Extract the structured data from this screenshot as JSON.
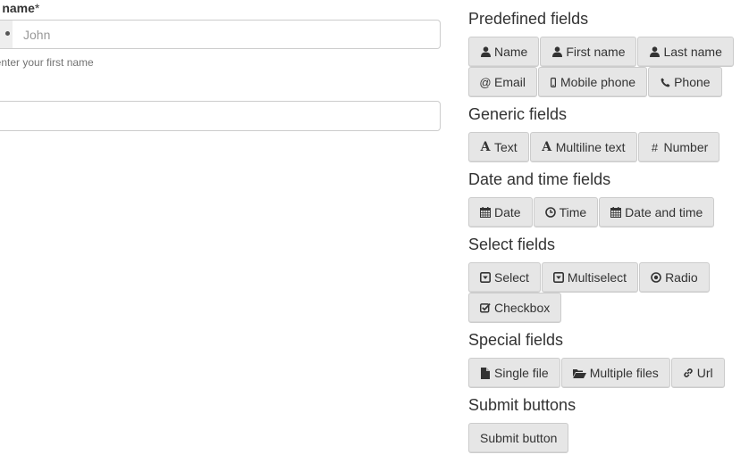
{
  "form": {
    "field_label": "st name",
    "required_mark": "*",
    "input_placeholder": "John",
    "help_text": "ase enter your first name"
  },
  "palette": {
    "predefined": {
      "title": "Predefined fields",
      "buttons": [
        {
          "label": "Name",
          "icon": "user-icon"
        },
        {
          "label": "First name",
          "icon": "user-icon"
        },
        {
          "label": "Last name",
          "icon": "user-icon"
        },
        {
          "label": "Email",
          "icon": "at-icon"
        },
        {
          "label": "Mobile phone",
          "icon": "mobile-icon"
        },
        {
          "label": "Phone",
          "icon": "phone-icon"
        }
      ]
    },
    "generic": {
      "title": "Generic fields",
      "buttons": [
        {
          "label": "Text",
          "icon": "font-icon"
        },
        {
          "label": "Multiline text",
          "icon": "font-icon"
        },
        {
          "label": "Number",
          "icon": "hash-icon"
        }
      ]
    },
    "datetime": {
      "title": "Date and time fields",
      "buttons": [
        {
          "label": "Date",
          "icon": "calendar-icon"
        },
        {
          "label": "Time",
          "icon": "clock-icon"
        },
        {
          "label": "Date and time",
          "icon": "calendar-icon"
        }
      ]
    },
    "select": {
      "title": "Select fields",
      "buttons": [
        {
          "label": "Select",
          "icon": "caret-square-icon"
        },
        {
          "label": "Multiselect",
          "icon": "caret-square-icon"
        },
        {
          "label": "Radio",
          "icon": "dot-circle-icon"
        },
        {
          "label": "Checkbox",
          "icon": "check-square-icon"
        }
      ]
    },
    "special": {
      "title": "Special fields",
      "buttons": [
        {
          "label": "Single file",
          "icon": "file-icon"
        },
        {
          "label": "Multiple files",
          "icon": "folder-open-icon"
        },
        {
          "label": "Url",
          "icon": "link-icon"
        }
      ]
    },
    "submit": {
      "title": "Submit buttons",
      "buttons": [
        {
          "label": "Submit button",
          "icon": ""
        }
      ]
    }
  }
}
